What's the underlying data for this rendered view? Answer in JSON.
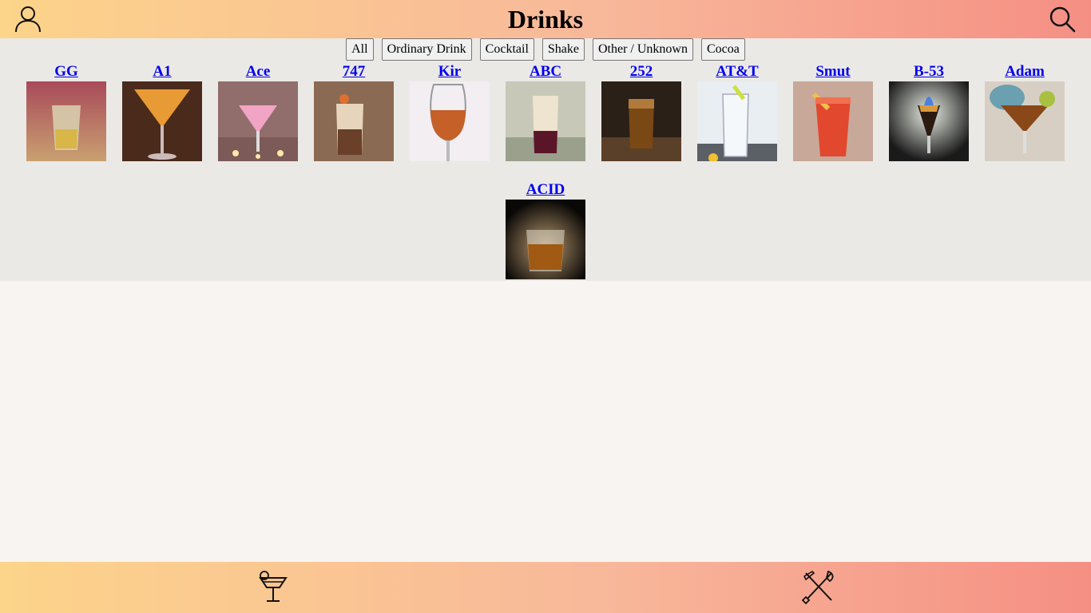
{
  "app": {
    "title": "Drinks"
  },
  "header": {
    "left_icon": "user-icon",
    "right_icon": "search-icon"
  },
  "filters": [
    "All",
    "Ordinary Drink",
    "Cocktail",
    "Shake",
    "Other / Unknown",
    "Cocoa"
  ],
  "drinks": [
    {
      "name": "GG"
    },
    {
      "name": "A1"
    },
    {
      "name": "Ace"
    },
    {
      "name": "747"
    },
    {
      "name": "Kir"
    },
    {
      "name": "ABC"
    },
    {
      "name": "252"
    },
    {
      "name": "AT&T"
    },
    {
      "name": "Smut"
    },
    {
      "name": "B-53"
    },
    {
      "name": "Adam"
    },
    {
      "name": "ACID"
    }
  ],
  "footer": {
    "left_icon": "cocktail-glass-icon",
    "right_icon": "fork-knife-icon"
  }
}
